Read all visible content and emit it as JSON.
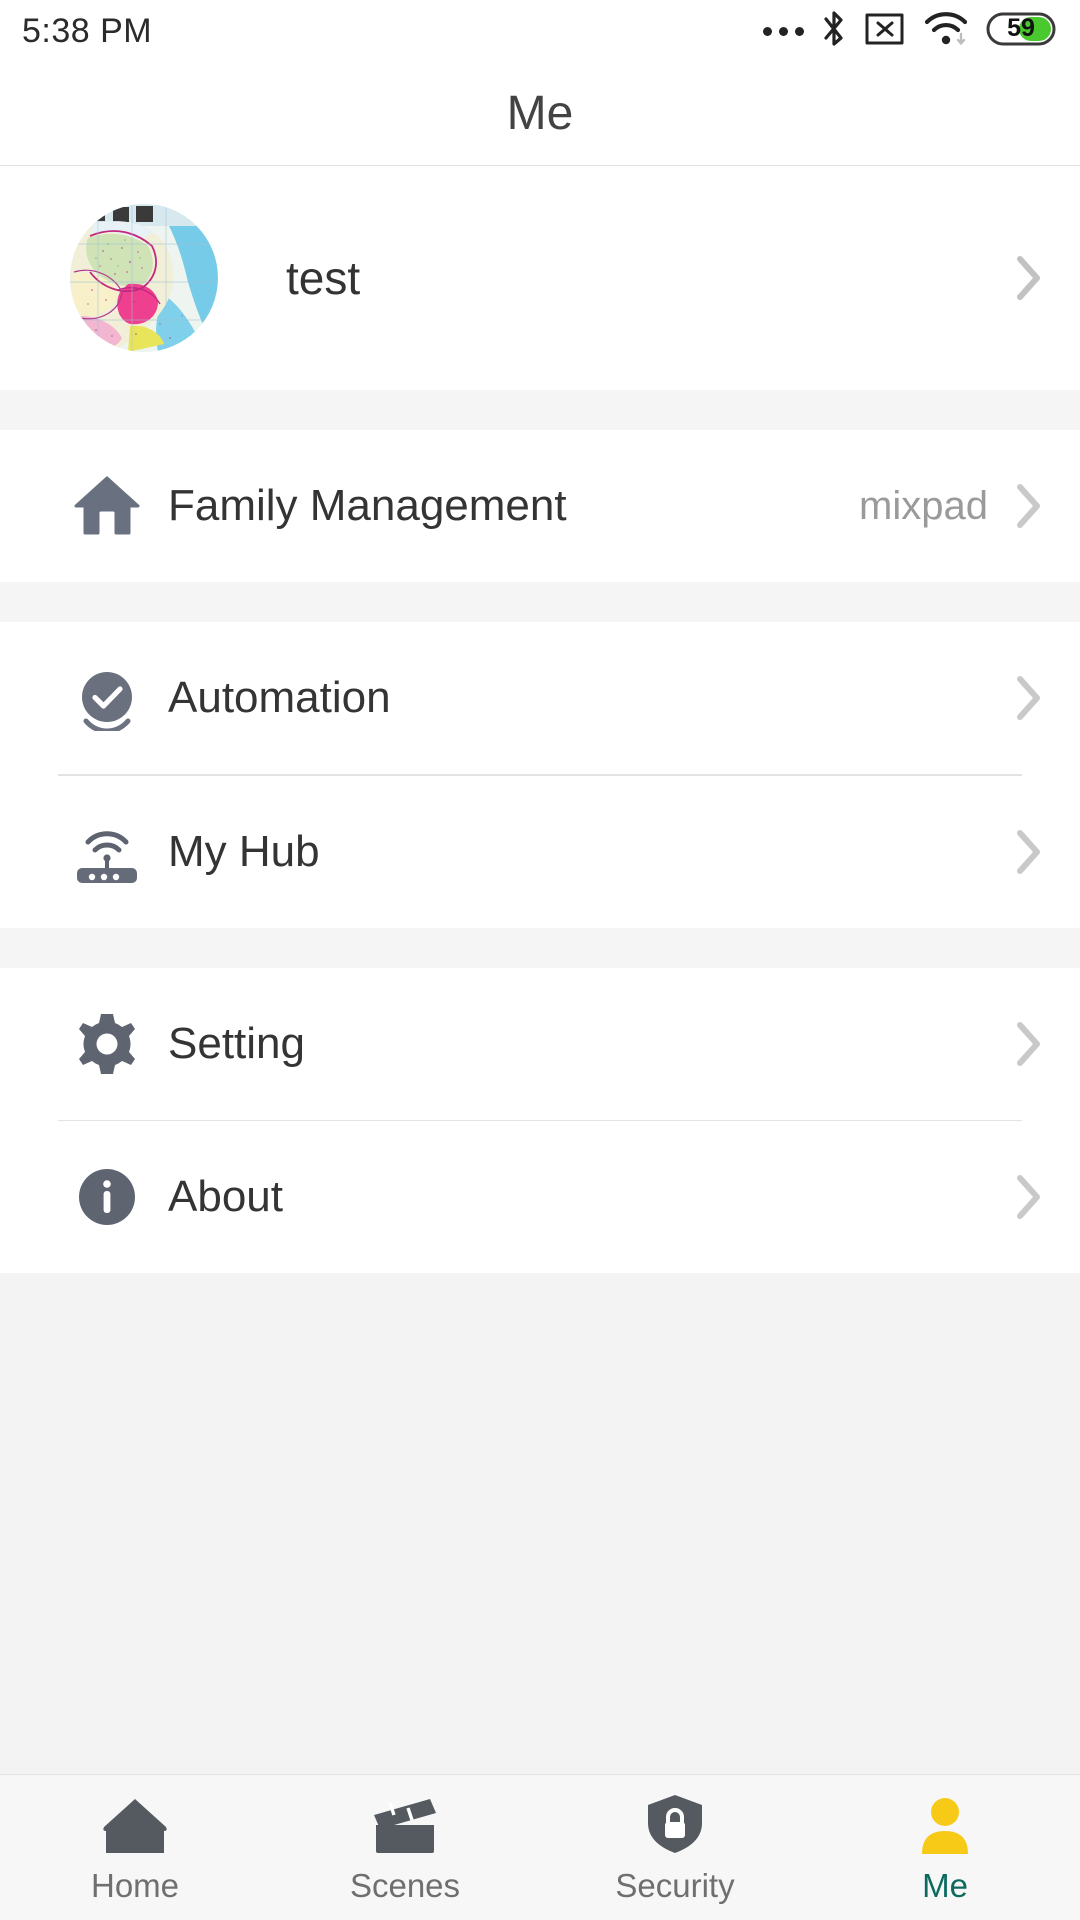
{
  "statusbar": {
    "time": "5:38 PM",
    "icons": [
      "more-dots-icon",
      "bluetooth-icon",
      "sim-card-disabled-icon",
      "wifi-icon",
      "battery-icon"
    ],
    "battery_level": "59",
    "battery_fill_color": "#4ac92f"
  },
  "header": {
    "title": "Me"
  },
  "profile": {
    "name": "test",
    "avatar": "map-photo-avatar",
    "chevron": "chevron-right-icon"
  },
  "groups": [
    {
      "items": [
        {
          "icon": "home-icon",
          "label": "Family Management",
          "value": "mixpad",
          "chevron": "chevron-right-icon"
        }
      ]
    },
    {
      "items": [
        {
          "icon": "check-circle-icon",
          "label": "Automation",
          "value": "",
          "chevron": "chevron-right-icon"
        },
        {
          "icon": "router-icon",
          "label": "My Hub",
          "value": "",
          "chevron": "chevron-right-icon"
        }
      ]
    },
    {
      "items": [
        {
          "icon": "gear-icon",
          "label": "Setting",
          "value": "",
          "chevron": "chevron-right-icon"
        },
        {
          "icon": "info-circle-icon",
          "label": "About",
          "value": "",
          "chevron": "chevron-right-icon"
        }
      ]
    }
  ],
  "bottomnav": {
    "active_color": "#0c6b5e",
    "active_icon_color": "#f7ca18",
    "inactive_color": "#6f6f6f",
    "items": [
      {
        "icon": "house-icon",
        "label": "Home",
        "active": false
      },
      {
        "icon": "clapperboard-icon",
        "label": "Scenes",
        "active": false
      },
      {
        "icon": "shield-lock-icon",
        "label": "Security",
        "active": false
      },
      {
        "icon": "person-icon",
        "label": "Me",
        "active": true
      }
    ]
  }
}
